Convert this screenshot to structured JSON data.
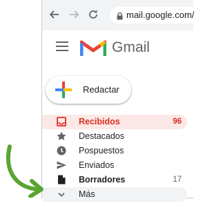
{
  "browser": {
    "url": "mail.google.com/",
    "back_icon": "arrow-left-icon",
    "forward_icon": "arrow-right-icon",
    "reload_icon": "reload-icon",
    "lock_icon": "lock-icon"
  },
  "header": {
    "logo_text": "Gmail",
    "menu_icon": "hamburger-menu-icon",
    "logo_icon": "gmail-m-logo"
  },
  "compose": {
    "label": "Redactar",
    "icon": "plus-icon"
  },
  "folders": [
    {
      "label": "Recibidos",
      "count": "96",
      "icon": "inbox-icon",
      "active": true
    },
    {
      "label": "Destacados",
      "count": "",
      "icon": "star-icon"
    },
    {
      "label": "Pospuestos",
      "count": "",
      "icon": "clock-icon"
    },
    {
      "label": "Enviados",
      "count": "",
      "icon": "send-icon"
    },
    {
      "label": "Borradores",
      "count": "17",
      "icon": "draft-icon",
      "bold": true
    },
    {
      "label": "Más",
      "count": "",
      "icon": "chevron-down-icon"
    }
  ],
  "colors": {
    "accent_red": "#d93025",
    "active_bg": "#fce8e6",
    "arrow_green": "#5aa531"
  }
}
